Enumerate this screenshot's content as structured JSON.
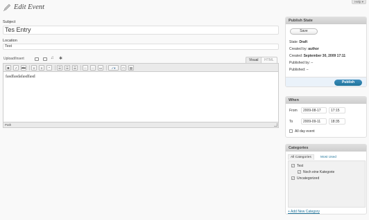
{
  "header": {
    "title": "Edit Event",
    "help_label": "Help ▾"
  },
  "subject": {
    "label": "Subject",
    "value": "Tes Entry"
  },
  "location": {
    "label": "Location",
    "value": "Test"
  },
  "editor": {
    "upload_label": "Upload/Insert",
    "tab_visual": "Visual",
    "tab_html": "HTML",
    "content": "fasdfasdafasdfasd",
    "path_label": "Path",
    "toolbar": {
      "bold": "B",
      "italic": "I",
      "strike": "abc",
      "quote": "“"
    }
  },
  "publish": {
    "title": "Publish State",
    "save_label": "Save",
    "state_label": "State:",
    "state_value": "Draft",
    "created_by_label": "Created by:",
    "created_by_value": "author",
    "created_label": "Created:",
    "created_value": "September 30, 2009 17:11",
    "published_by_label": "Published by:",
    "published_by_value": "–",
    "published_label": "Published:",
    "published_value": "–",
    "publish_button": "Publish"
  },
  "when": {
    "title": "When",
    "from_label": "From",
    "from_date": "2009-08-17",
    "from_time": "17:15",
    "to_label": "To",
    "to_date": "2009-09-11",
    "to_time": "18:35",
    "all_day_label": "All day event"
  },
  "categories": {
    "title": "Categories",
    "tab_all": "All Categories",
    "tab_most_used": "Most Used",
    "items": [
      {
        "label": "Test",
        "checked": true
      },
      {
        "label": "Noch eine Kategorie",
        "checked": true
      },
      {
        "label": "Uncategorized",
        "checked": true
      }
    ],
    "add_link": "+ Add New Category"
  }
}
